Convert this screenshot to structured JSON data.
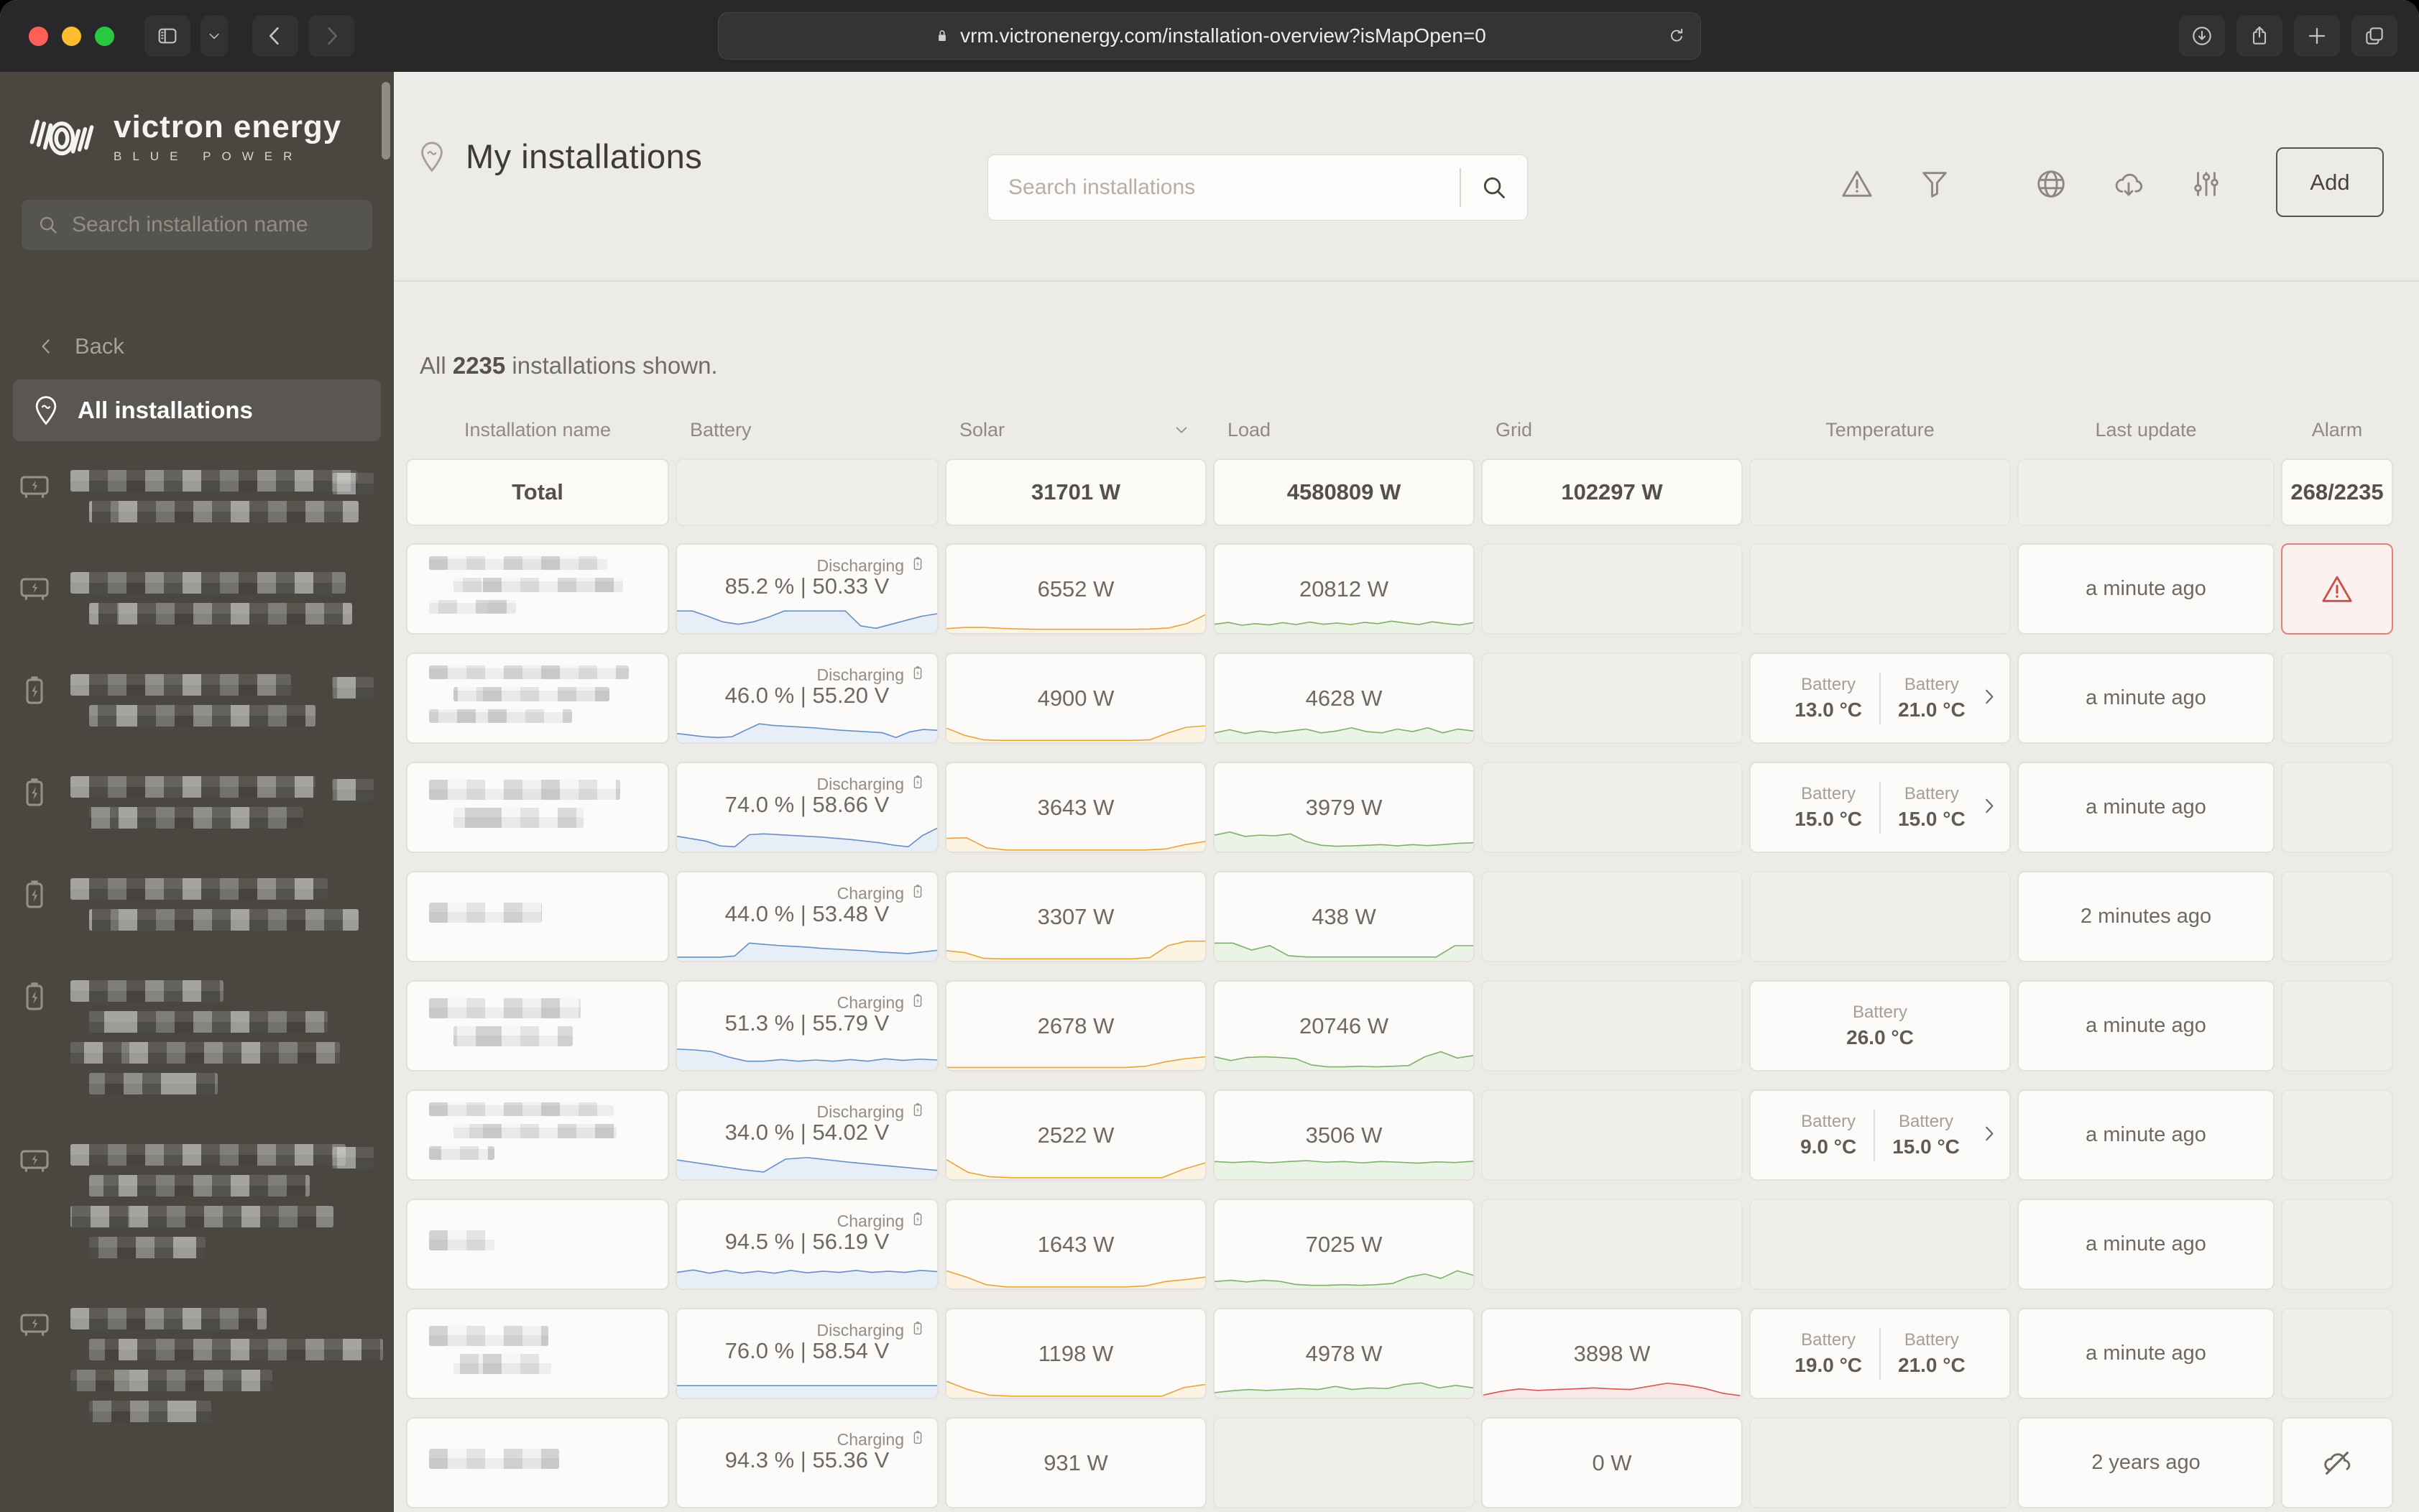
{
  "browser": {
    "url": "vrm.victronenergy.com/installation-overview?isMapOpen=0",
    "icons": [
      "sidebar-toggle-icon",
      "chevron-down-icon",
      "back-icon",
      "forward-icon",
      "lock-icon",
      "reload-icon",
      "downloads-icon",
      "share-icon",
      "new-tab-icon",
      "tabs-icon"
    ]
  },
  "sidebar": {
    "logo": {
      "title": "victron energy",
      "subtitle": "BLUE POWER"
    },
    "search_placeholder": "Search installation name",
    "back_label": "Back",
    "all_installations_label": "All installations",
    "items": [
      {
        "icon": "inverter-icon",
        "badge": true,
        "lines": [
          0.94,
          0.88
        ]
      },
      {
        "icon": "inverter-icon",
        "badge": false,
        "lines": [
          0.9,
          0.86
        ]
      },
      {
        "icon": "battery-icon",
        "badge": true,
        "lines": [
          0.72,
          0.74
        ]
      },
      {
        "icon": "battery-icon",
        "badge": true,
        "lines": [
          0.8,
          0.7
        ]
      },
      {
        "icon": "battery-icon",
        "badge": false,
        "lines": [
          0.84,
          0.88
        ]
      },
      {
        "icon": "battery-icon",
        "badge": false,
        "lines": [
          0.5,
          0.78,
          0.88,
          0.42
        ]
      },
      {
        "icon": "inverter-icon",
        "badge": true,
        "lines": [
          0.9,
          0.72,
          0.86,
          0.38
        ]
      },
      {
        "icon": "inverter-icon",
        "badge": false,
        "lines": [
          0.64,
          0.96,
          0.66,
          0.4
        ]
      }
    ]
  },
  "header": {
    "title": "My installations",
    "search_placeholder": "Search installations",
    "add_label": "Add",
    "icons": [
      "alarm-warning-icon",
      "filter-icon",
      "globe-icon",
      "cloud-download-icon",
      "column-settings-icon"
    ]
  },
  "summary": {
    "prefix": "All ",
    "count": "2235",
    "suffix": " installations shown."
  },
  "table": {
    "columns": [
      "Installation name",
      "Battery",
      "Solar",
      "Load",
      "Grid",
      "Temperature",
      "Last update",
      "Alarm"
    ],
    "total": {
      "label": "Total",
      "solar": "31701 W",
      "load": "4580809 W",
      "grid": "102297 W",
      "alarm": "268/2235"
    },
    "rows": [
      {
        "name_lines": [
          0.82,
          0.78,
          0.4
        ],
        "battery": {
          "state": "Discharging",
          "value": "85.2 % | 50.33 V",
          "spark": [
            55,
            55,
            42,
            28,
            22,
            28,
            40,
            55,
            55,
            55,
            55,
            55,
            18,
            12,
            22,
            32,
            42,
            48
          ]
        },
        "solar": {
          "value": "6552 W",
          "spark": [
            14,
            18,
            18,
            15,
            13,
            12,
            12,
            12,
            12,
            12,
            12,
            13,
            16,
            30,
            58
          ]
        },
        "load": {
          "value": "20812 W",
          "spark": [
            28,
            34,
            25,
            30,
            26,
            33,
            27,
            35,
            28,
            32,
            27,
            34,
            30,
            38,
            32,
            27,
            36,
            30,
            26,
            33
          ]
        },
        "grid": null,
        "temp": {
          "type": "none"
        },
        "last_update": "a minute ago",
        "alarm": "alarm"
      },
      {
        "name_lines": [
          0.92,
          0.72,
          0.66
        ],
        "battery": {
          "state": "Discharging",
          "value": "46.0 % | 55.20 V",
          "spark": [
            22,
            18,
            14,
            12,
            14,
            30,
            46,
            42,
            40,
            38,
            36,
            33,
            30,
            28,
            26,
            24,
            12,
            26,
            32,
            30
          ]
        },
        "solar": {
          "value": "4900 W",
          "spark": [
            45,
            22,
            8,
            6,
            6,
            6,
            6,
            6,
            6,
            6,
            6,
            8,
            30,
            48,
            52
          ]
        },
        "load": {
          "value": "4628 W",
          "spark": [
            30,
            40,
            28,
            36,
            30,
            36,
            42,
            30,
            36,
            46,
            34,
            30,
            42,
            34,
            46,
            30,
            42,
            36
          ]
        },
        "grid": null,
        "temp": {
          "type": "double",
          "t1_label": "Battery",
          "t1": "13.0 °C",
          "t2_label": "Battery",
          "t2": "21.0 °C",
          "chevron": true
        },
        "last_update": "a minute ago",
        "alarm": "none"
      },
      {
        "name_lines": [
          0.88,
          0.6
        ],
        "battery": {
          "state": "Discharging",
          "value": "74.0 % | 58.66 V",
          "spark": [
            38,
            32,
            26,
            14,
            12,
            42,
            44,
            42,
            40,
            38,
            36,
            33,
            30,
            26,
            22,
            16,
            12,
            40,
            58
          ]
        },
        "solar": {
          "value": "3643 W",
          "spark": [
            42,
            44,
            12,
            5,
            5,
            5,
            5,
            5,
            5,
            5,
            5,
            8,
            22,
            32
          ]
        },
        "load": {
          "value": "3979 W",
          "spark": [
            52,
            62,
            48,
            52,
            50,
            56,
            32,
            20,
            17,
            18,
            20,
            22,
            18,
            22,
            19,
            22,
            26,
            28
          ]
        },
        "grid": null,
        "temp": {
          "type": "double",
          "t1_label": "Battery",
          "t1": "15.0 °C",
          "t2_label": "Battery",
          "t2": "15.0 °C",
          "chevron": true
        },
        "last_update": "a minute ago",
        "alarm": "none"
      },
      {
        "name_lines": [
          0.52
        ],
        "battery": {
          "state": "Charging",
          "value": "44.0 % | 53.48 V",
          "spark": [
            9,
            9,
            9,
            9,
            12,
            44,
            41,
            38,
            36,
            34,
            31,
            29,
            27,
            25,
            22,
            20,
            18,
            22,
            26
          ]
        },
        "solar": {
          "value": "3307 W",
          "spark": [
            32,
            26,
            8,
            6,
            6,
            6,
            6,
            6,
            6,
            6,
            6,
            10,
            48,
            62,
            62
          ]
        },
        "load": {
          "value": "438 W",
          "spark": [
            56,
            56,
            34,
            48,
            16,
            12,
            12,
            12,
            12,
            12,
            12,
            12,
            12,
            48,
            48
          ]
        },
        "grid": null,
        "temp": {
          "type": "none"
        },
        "last_update": "2 minutes ago",
        "alarm": "none"
      },
      {
        "name_lines": [
          0.7,
          0.55
        ],
        "battery": {
          "state": "Charging",
          "value": "51.3 % | 55.79 V",
          "spark": [
            52,
            50,
            46,
            32,
            22,
            22,
            26,
            22,
            25,
            22,
            26,
            22,
            28,
            24,
            27,
            25
          ]
        },
        "solar": {
          "value": "2678 W",
          "spark": [
            8,
            8,
            8,
            8,
            8,
            8,
            8,
            8,
            8,
            8,
            12,
            26,
            36,
            42
          ]
        },
        "load": {
          "value": "20746 W",
          "spark": [
            42,
            30,
            40,
            42,
            40,
            36,
            16,
            10,
            10,
            12,
            10,
            12,
            14,
            42,
            58,
            38,
            46
          ]
        },
        "grid": null,
        "temp": {
          "type": "single",
          "t1_label": "Battery",
          "t1": "26.0 °C"
        },
        "last_update": "a minute ago",
        "alarm": "none"
      },
      {
        "name_lines": [
          0.85,
          0.75,
          0.3
        ],
        "battery": {
          "state": "Discharging",
          "value": "34.0 % | 54.02 V",
          "spark": [
            48,
            40,
            32,
            24,
            18,
            50,
            54,
            48,
            42,
            37,
            32,
            27,
            22
          ]
        },
        "solar": {
          "value": "2522 W",
          "spark": [
            62,
            22,
            8,
            5,
            5,
            5,
            5,
            5,
            5,
            5,
            5,
            32,
            52
          ]
        },
        "load": {
          "value": "3506 W",
          "spark": [
            56,
            53,
            56,
            52,
            56,
            59,
            54,
            56,
            52,
            56,
            54,
            51,
            55,
            53,
            57
          ]
        },
        "grid": null,
        "temp": {
          "type": "double",
          "t1_label": "Battery",
          "t1": "9.0 °C",
          "t2_label": "Battery",
          "t2": "15.0 °C",
          "chevron": true
        },
        "last_update": "a minute ago",
        "alarm": "none"
      },
      {
        "name_lines": [
          0.3
        ],
        "battery": {
          "state": "Charging",
          "value": "94.5 % | 56.19 V",
          "spark": [
            40,
            46,
            38,
            45,
            38,
            43,
            38,
            45,
            39,
            43,
            40,
            45,
            40,
            43,
            40,
            45,
            42
          ]
        },
        "solar": {
          "value": "1643 W",
          "spark": [
            56,
            36,
            12,
            5,
            5,
            5,
            5,
            5,
            5,
            5,
            8,
            22,
            28,
            36
          ]
        },
        "load": {
          "value": "7025 W",
          "spark": [
            22,
            26,
            21,
            26,
            23,
            13,
            10,
            10,
            12,
            10,
            12,
            16,
            36,
            46,
            32,
            56,
            42
          ]
        },
        "grid": null,
        "temp": {
          "type": "none"
        },
        "last_update": "a minute ago",
        "alarm": "none"
      },
      {
        "name_lines": [
          0.55,
          0.45
        ],
        "battery": {
          "state": "Discharging",
          "value": "76.0 % | 58.54 V",
          "spark": [
            30,
            30,
            30,
            30,
            30,
            30,
            30,
            30,
            30,
            30,
            30,
            30
          ]
        },
        "solar": {
          "value": "1198 W",
          "spark": [
            52,
            26,
            8,
            5,
            5,
            5,
            5,
            5,
            5,
            5,
            5,
            32,
            42
          ]
        },
        "load": {
          "value": "4978 W",
          "spark": [
            16,
            22,
            26,
            23,
            26,
            29,
            26,
            36,
            26,
            31,
            29,
            42,
            47,
            31,
            39,
            31
          ]
        },
        "grid": {
          "value": "3898 W",
          "spark": [
            8,
            20,
            28,
            23,
            26,
            28,
            31,
            28,
            26,
            36,
            46,
            40,
            30,
            14,
            6
          ]
        },
        "temp": {
          "type": "double",
          "t1_label": "Battery",
          "t1": "19.0 °C",
          "t2_label": "Battery",
          "t2": "21.0 °C",
          "chevron": false
        },
        "last_update": "a minute ago",
        "alarm": "none"
      },
      {
        "name_lines": [
          0.6
        ],
        "battery": {
          "state": "Charging",
          "value": "94.3 % | 55.36 V",
          "spark": null
        },
        "solar": {
          "value": "931 W",
          "spark": null
        },
        "load": null,
        "grid": {
          "value": "0 W",
          "spark": null
        },
        "temp": {
          "type": "none"
        },
        "last_update": "2 years ago",
        "alarm": "disconnected"
      }
    ]
  },
  "colors": {
    "battery_spark": "#6590c6",
    "battery_fill": "#e7eef8",
    "solar_spark": "#e8a33d",
    "solar_fill": "#fdf3e1",
    "load_spark": "#7fb069",
    "load_fill": "#eaf3e5",
    "grid_spark": "#d9534f",
    "grid_fill": "#fbe7e6",
    "alarm_red": "#cc5049",
    "sidebar_bg": "#4a4741",
    "page_bg": "#edebe7"
  }
}
